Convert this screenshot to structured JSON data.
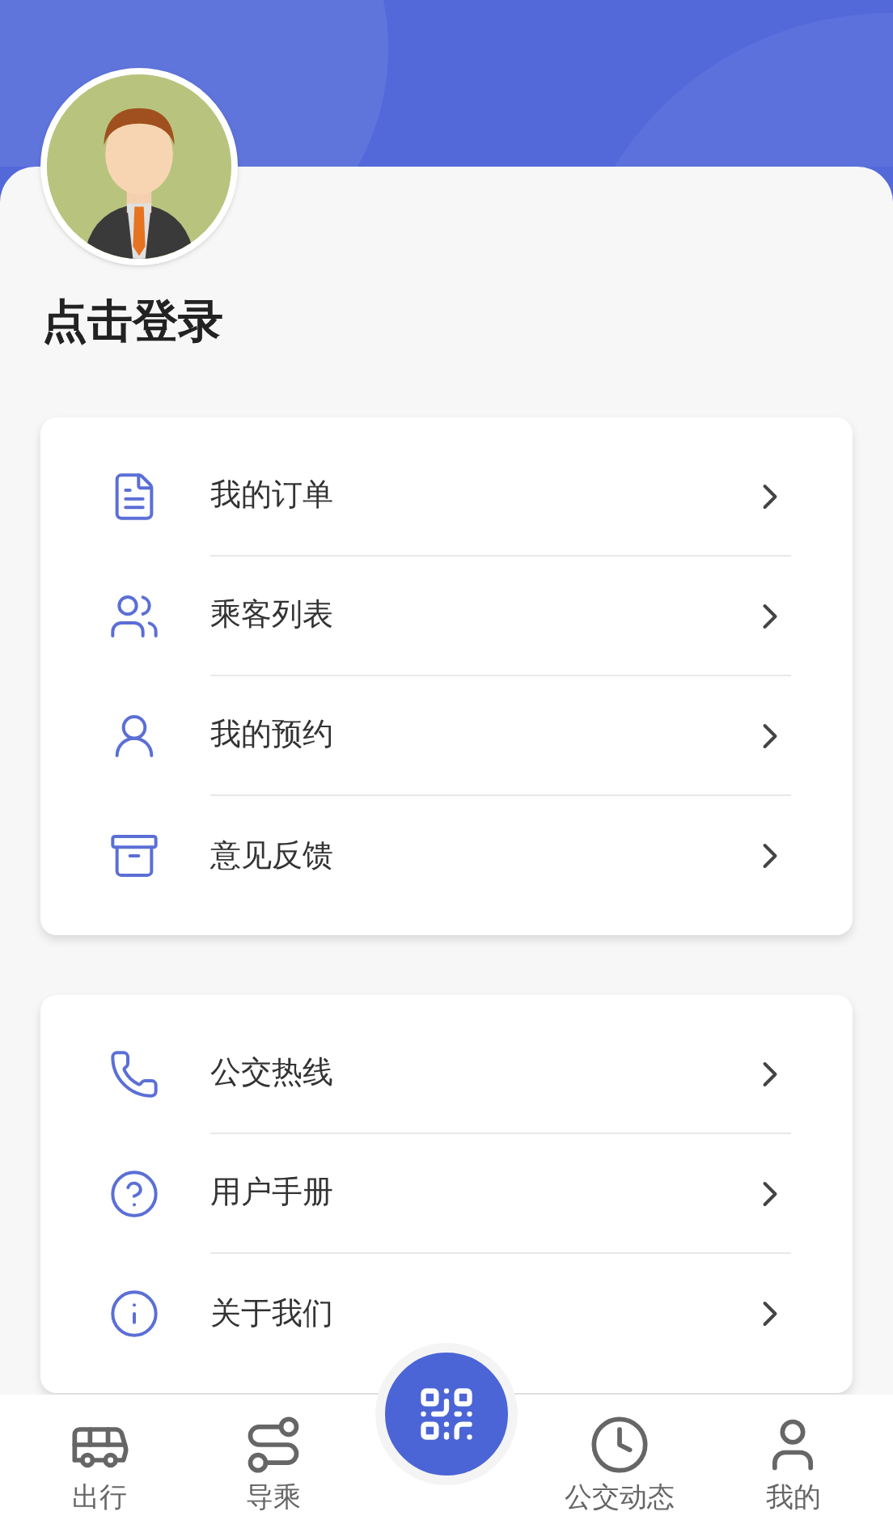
{
  "profile": {
    "login_label": "点击登录"
  },
  "menu_groups": [
    {
      "items": [
        {
          "kind": "orders",
          "label": "我的订单"
        },
        {
          "kind": "passengers",
          "label": "乘客列表"
        },
        {
          "kind": "reservations",
          "label": "我的预约"
        },
        {
          "kind": "feedback",
          "label": "意见反馈"
        }
      ]
    },
    {
      "items": [
        {
          "kind": "hotline",
          "label": "公交热线"
        },
        {
          "kind": "manual",
          "label": "用户手册"
        },
        {
          "kind": "about",
          "label": "关于我们"
        }
      ]
    }
  ],
  "tab_bar": [
    {
      "kind": "bus",
      "label": "出行"
    },
    {
      "kind": "route",
      "label": "导乘"
    },
    {
      "kind": "scan"
    },
    {
      "kind": "live",
      "label": "公交动态"
    },
    {
      "kind": "me",
      "label": "我的"
    }
  ]
}
